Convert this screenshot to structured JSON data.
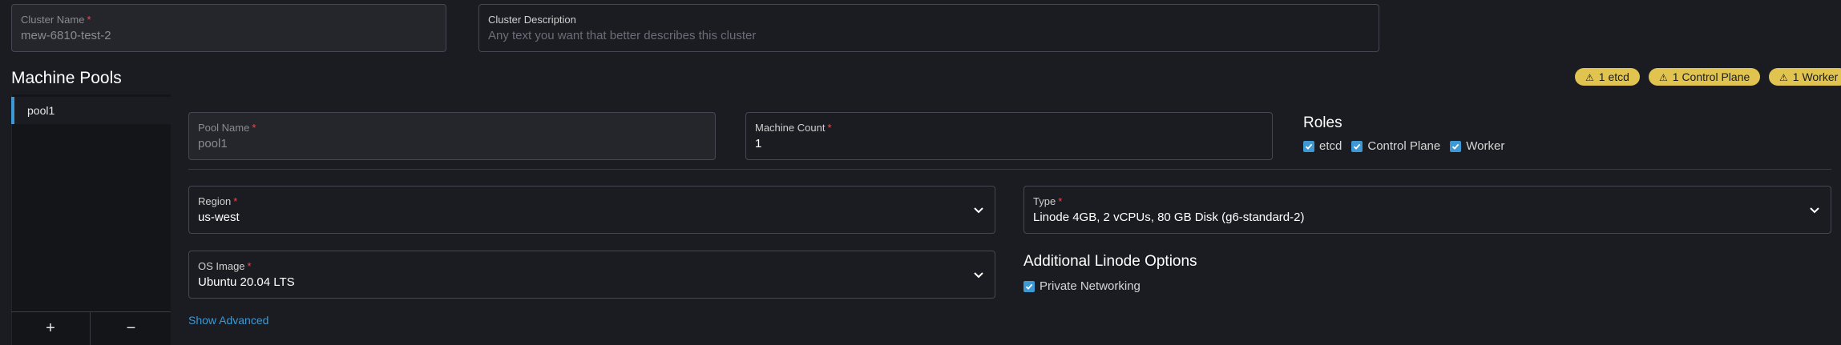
{
  "cluster": {
    "name_label": "Cluster Name",
    "name_value": "mew-6810-test-2",
    "description_label": "Cluster Description",
    "description_placeholder": "Any text you want that better describes this cluster"
  },
  "machine_pools": {
    "title": "Machine Pools",
    "badges": [
      {
        "icon": "warning-icon",
        "label": "1 etcd"
      },
      {
        "icon": "warning-icon",
        "label": "1 Control Plane"
      },
      {
        "icon": "warning-icon",
        "label": "1 Worker"
      }
    ],
    "pools": [
      {
        "label": "pool1"
      }
    ],
    "add_label": "+",
    "remove_label": "−"
  },
  "pool_form": {
    "pool_name_label": "Pool Name",
    "pool_name_value": "pool1",
    "machine_count_label": "Machine Count",
    "machine_count_value": "1",
    "roles_title": "Roles",
    "roles": [
      {
        "label": "etcd",
        "checked": true
      },
      {
        "label": "Control Plane",
        "checked": true
      },
      {
        "label": "Worker",
        "checked": true
      }
    ],
    "region_label": "Region",
    "region_value": "us-west",
    "type_label": "Type",
    "type_value": "Linode 4GB, 2 vCPUs, 80 GB Disk (g6-standard-2)",
    "os_image_label": "OS Image",
    "os_image_value": "Ubuntu 20.04 LTS",
    "additional_title": "Additional Linode Options",
    "private_networking_label": "Private Networking",
    "show_advanced_label": "Show Advanced"
  },
  "colors": {
    "background": "#1b1c21",
    "accent": "#3d98d3",
    "warning_badge": "#e0c44f",
    "required": "#f64747"
  }
}
